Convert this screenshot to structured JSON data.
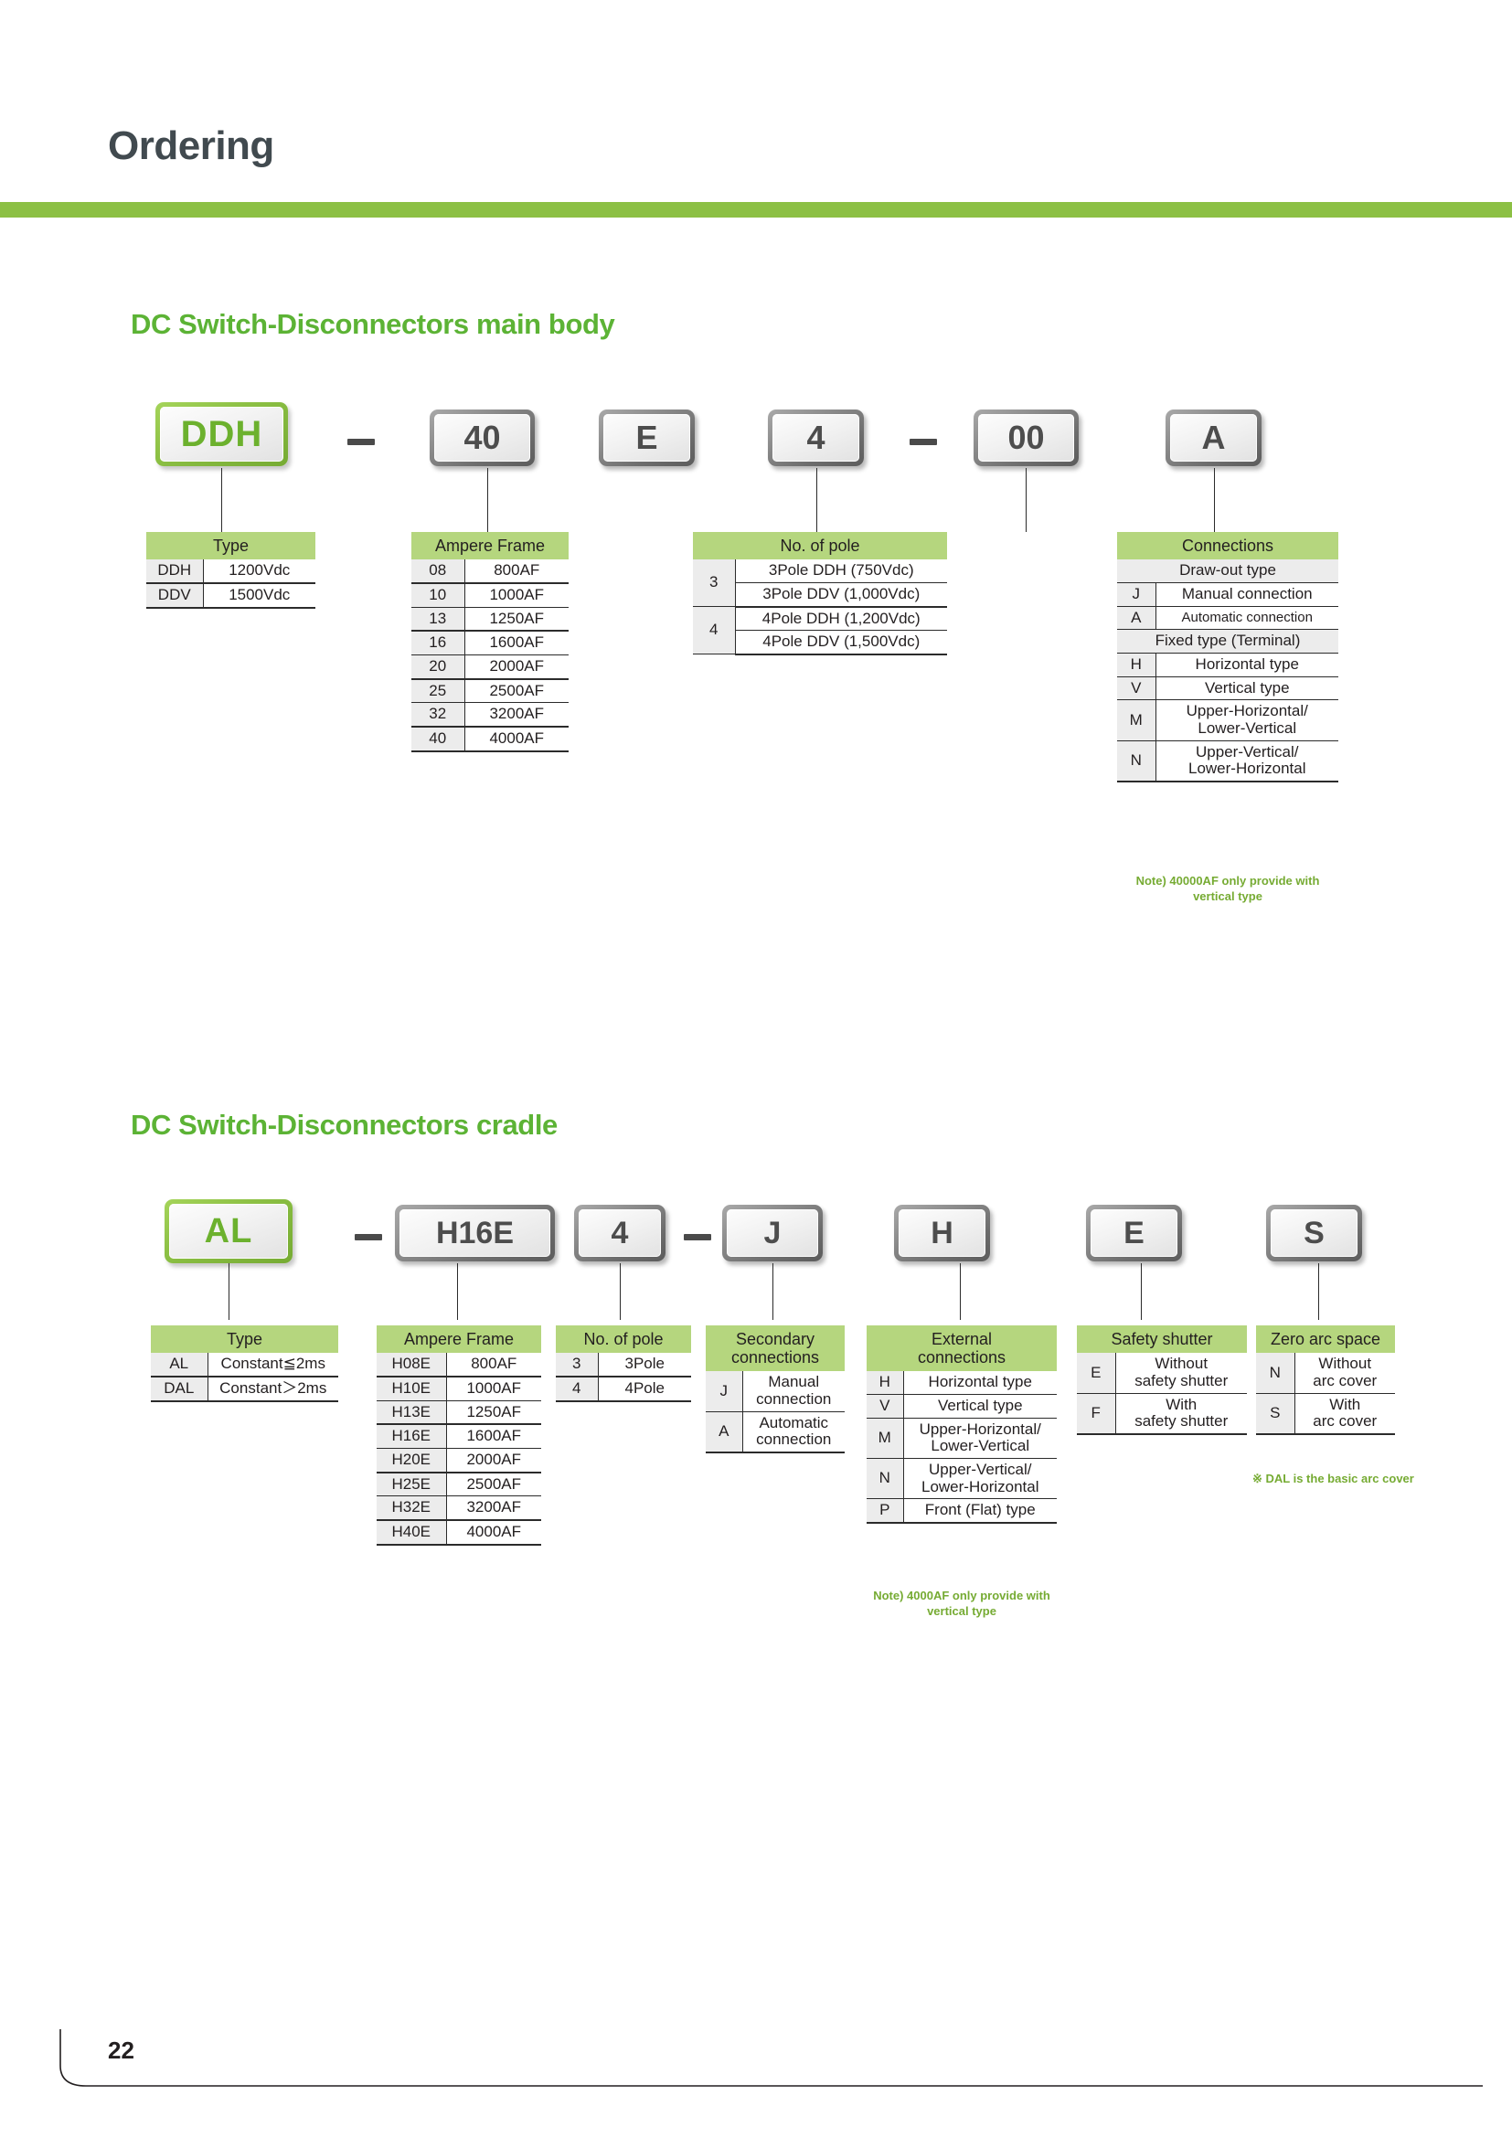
{
  "header": {
    "title": "Ordering",
    "accent_color": "#8cc044"
  },
  "footer": {
    "page_number": "22"
  },
  "sections": [
    {
      "title": "DC Switch-Disconnectors main body",
      "code_boxes": [
        {
          "label": "DDH",
          "style": "green"
        },
        {
          "label": "–",
          "style": "dash"
        },
        {
          "label": "40",
          "style": "grey"
        },
        {
          "label": "E",
          "style": "grey"
        },
        {
          "label": "4",
          "style": "grey"
        },
        {
          "label": "–",
          "style": "dash"
        },
        {
          "label": "00",
          "style": "grey"
        },
        {
          "label": "A",
          "style": "grey"
        }
      ],
      "tables": [
        {
          "name": "type",
          "header": "Type",
          "rows": [
            {
              "code": "DDH",
              "value": "1200Vdc"
            },
            {
              "code": "DDV",
              "value": "1500Vdc"
            }
          ]
        },
        {
          "name": "ampere-frame",
          "header": "Ampere Frame",
          "rows": [
            {
              "code": "08",
              "value": "800AF"
            },
            {
              "code": "10",
              "value": "1000AF"
            },
            {
              "code": "13",
              "value": "1250AF"
            },
            {
              "code": "16",
              "value": "1600AF"
            },
            {
              "code": "20",
              "value": "2000AF"
            },
            {
              "code": "25",
              "value": "2500AF"
            },
            {
              "code": "32",
              "value": "3200AF"
            },
            {
              "code": "40",
              "value": "4000AF"
            }
          ]
        },
        {
          "name": "no-of-pole",
          "header": "No. of pole",
          "groups": [
            {
              "code": "3",
              "values": [
                "3Pole  DDH (750Vdc)",
                "3Pole  DDV (1,000Vdc)"
              ]
            },
            {
              "code": "4",
              "values": [
                "4Pole  DDH (1,200Vdc)",
                "4Pole  DDV (1,500Vdc)"
              ]
            }
          ]
        },
        {
          "name": "connections",
          "header": "Connections",
          "subheader_1": "Draw-out type",
          "rows_1": [
            {
              "code": "J",
              "value": "Manual connection"
            },
            {
              "code": "A",
              "value": "Automatic connection"
            }
          ],
          "subheader_2": "Fixed type (Terminal)",
          "rows_2": [
            {
              "code": "H",
              "value": "Horizontal type"
            },
            {
              "code": "V",
              "value": "Vertical type"
            },
            {
              "code": "M",
              "value": "Upper-Horizontal/\nLower-Vertical"
            },
            {
              "code": "N",
              "value": "Upper-Vertical/\nLower-Horizontal"
            }
          ],
          "note": "Note) 40000AF only provide with vertical type"
        }
      ]
    },
    {
      "title": "DC Switch-Disconnectors cradle",
      "code_boxes": [
        {
          "label": "AL",
          "style": "green"
        },
        {
          "label": "–",
          "style": "dash"
        },
        {
          "label": "H16E",
          "style": "grey"
        },
        {
          "label": "4",
          "style": "grey"
        },
        {
          "label": "–",
          "style": "dash"
        },
        {
          "label": "J",
          "style": "grey"
        },
        {
          "label": "H",
          "style": "grey"
        },
        {
          "label": "E",
          "style": "grey"
        },
        {
          "label": "S",
          "style": "grey"
        }
      ],
      "tables": [
        {
          "name": "type",
          "header": "Type",
          "rows": [
            {
              "code": "AL",
              "value": "Constant≦2ms"
            },
            {
              "code": "DAL",
              "value": "Constant＞2ms"
            }
          ]
        },
        {
          "name": "ampere-frame",
          "header": "Ampere Frame",
          "rows": [
            {
              "code": "H08E",
              "value": "800AF"
            },
            {
              "code": "H10E",
              "value": "1000AF"
            },
            {
              "code": "H13E",
              "value": "1250AF"
            },
            {
              "code": "H16E",
              "value": "1600AF"
            },
            {
              "code": "H20E",
              "value": "2000AF"
            },
            {
              "code": "H25E",
              "value": "2500AF"
            },
            {
              "code": "H32E",
              "value": "3200AF"
            },
            {
              "code": "H40E",
              "value": "4000AF"
            }
          ]
        },
        {
          "name": "no-of-pole",
          "header": "No. of pole",
          "rows": [
            {
              "code": "3",
              "value": "3Pole"
            },
            {
              "code": "4",
              "value": "4Pole"
            }
          ]
        },
        {
          "name": "secondary-connections",
          "header": "Secondary\nconnections",
          "rows": [
            {
              "code": "J",
              "value": "Manual\nconnection"
            },
            {
              "code": "A",
              "value": "Automatic\nconnection"
            }
          ]
        },
        {
          "name": "external-connections",
          "header": "External\nconnections",
          "rows": [
            {
              "code": "H",
              "value": "Horizontal type"
            },
            {
              "code": "V",
              "value": "Vertical type"
            },
            {
              "code": "M",
              "value": "Upper-Horizontal/\nLower-Vertical"
            },
            {
              "code": "N",
              "value": "Upper-Vertical/\nLower-Horizontal"
            },
            {
              "code": "P",
              "value": "Front (Flat) type"
            }
          ],
          "note": "Note) 4000AF only provide with vertical type"
        },
        {
          "name": "safety-shutter",
          "header": "Safety shutter",
          "rows": [
            {
              "code": "E",
              "value": "Without\nsafety shutter"
            },
            {
              "code": "F",
              "value": "With\nsafety shutter"
            }
          ]
        },
        {
          "name": "zero-arc-space",
          "header": "Zero arc space",
          "rows": [
            {
              "code": "N",
              "value": "Without\narc cover"
            },
            {
              "code": "S",
              "value": "With\narc cover"
            }
          ],
          "note": "※ DAL is the basic arc cover"
        }
      ]
    }
  ]
}
